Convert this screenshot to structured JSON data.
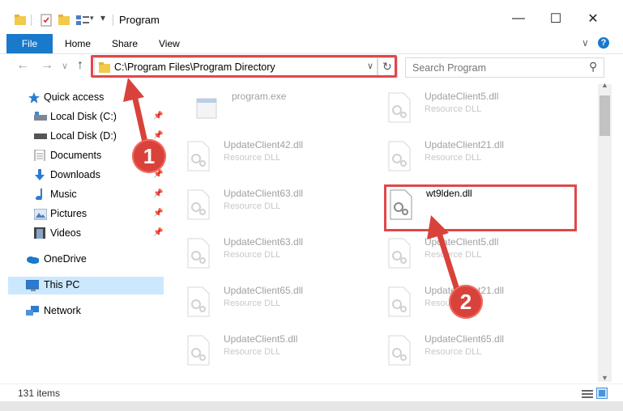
{
  "window": {
    "title": "Program",
    "minimize_glyph": "—",
    "maximize_glyph": "☐",
    "close_glyph": "✕"
  },
  "ribbon": {
    "tabs": [
      {
        "label": "File"
      },
      {
        "label": "Home"
      },
      {
        "label": "Share"
      },
      {
        "label": "View"
      }
    ],
    "expand_glyph": "∨",
    "help_glyph": "?"
  },
  "address": {
    "path": "C:\\Program Files\\Program Directory",
    "dropdown_glyph": "∨",
    "refresh_glyph": "↻"
  },
  "search": {
    "placeholder": "Search Program",
    "icon_glyph": "⚲"
  },
  "navigation": {
    "back_glyph": "←",
    "forward_glyph": "→",
    "recent_glyph": "∨",
    "up_glyph": "↑",
    "items": [
      {
        "label": "Quick access"
      },
      {
        "label": "Local Disk (C:)"
      },
      {
        "label": "Local Disk (D:)"
      },
      {
        "label": "Documents"
      },
      {
        "label": "Downloads"
      },
      {
        "label": "Music"
      },
      {
        "label": "Pictures"
      },
      {
        "label": "Videos"
      },
      {
        "label": "OneDrive"
      },
      {
        "label": "This PC"
      },
      {
        "label": "Network"
      }
    ]
  },
  "files": [
    {
      "name": "program.exe",
      "type": ""
    },
    {
      "name": "UpdateClient5.dll",
      "type": "Resource DLL"
    },
    {
      "name": "UpdateClient42.dll",
      "type": "Resource DLL"
    },
    {
      "name": "UpdateClient21.dll",
      "type": "Resource DLL"
    },
    {
      "name": "UpdateClient63.dll",
      "type": "Resource DLL"
    },
    {
      "name": "wt9lden.dll",
      "type": ""
    },
    {
      "name": "UpdateClient63.dll",
      "type": "Resource DLL"
    },
    {
      "name": "UpdateClient5.dll",
      "type": "Resource DLL"
    },
    {
      "name": "UpdateClient65.dll",
      "type": "Resource DLL"
    },
    {
      "name": "UpdateClient21.dll",
      "type": "Resource DLL"
    },
    {
      "name": "UpdateClient5.dll",
      "type": "Resource DLL"
    },
    {
      "name": "UpdateClient65.dll",
      "type": "Resource DLL"
    }
  ],
  "status": {
    "item_count": "131 items"
  },
  "annotations": {
    "step1": "1",
    "step2": "2",
    "highlight_color": "#e0474c"
  },
  "colors": {
    "accent": "#1979ca",
    "selection": "#cce8ff",
    "annotation": "#d9423a"
  }
}
